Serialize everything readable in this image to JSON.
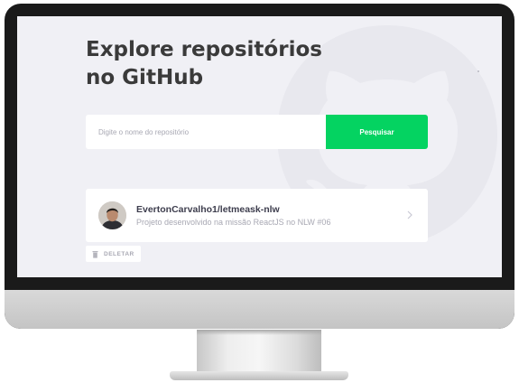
{
  "page": {
    "title": "Explore repositórios\nno GitHub"
  },
  "search": {
    "placeholder": "Digite o nome do repositório",
    "button_label": "Pesquisar"
  },
  "repositories": [
    {
      "name": "EvertonCarvalho1/letmeask-nlw",
      "description": "Projeto desenvolvido na missão ReactJS no NLW #06"
    }
  ],
  "delete_button": {
    "label": "DELETAR"
  },
  "colors": {
    "accent": "#04d361",
    "background": "#f0f0f5",
    "title": "#3a3a3a",
    "muted": "#a8a8b3"
  },
  "icons": {
    "background_logo": "github-logo-icon",
    "avatar": "avatar",
    "chevron": "chevron-right-icon",
    "trash": "trash-icon"
  }
}
